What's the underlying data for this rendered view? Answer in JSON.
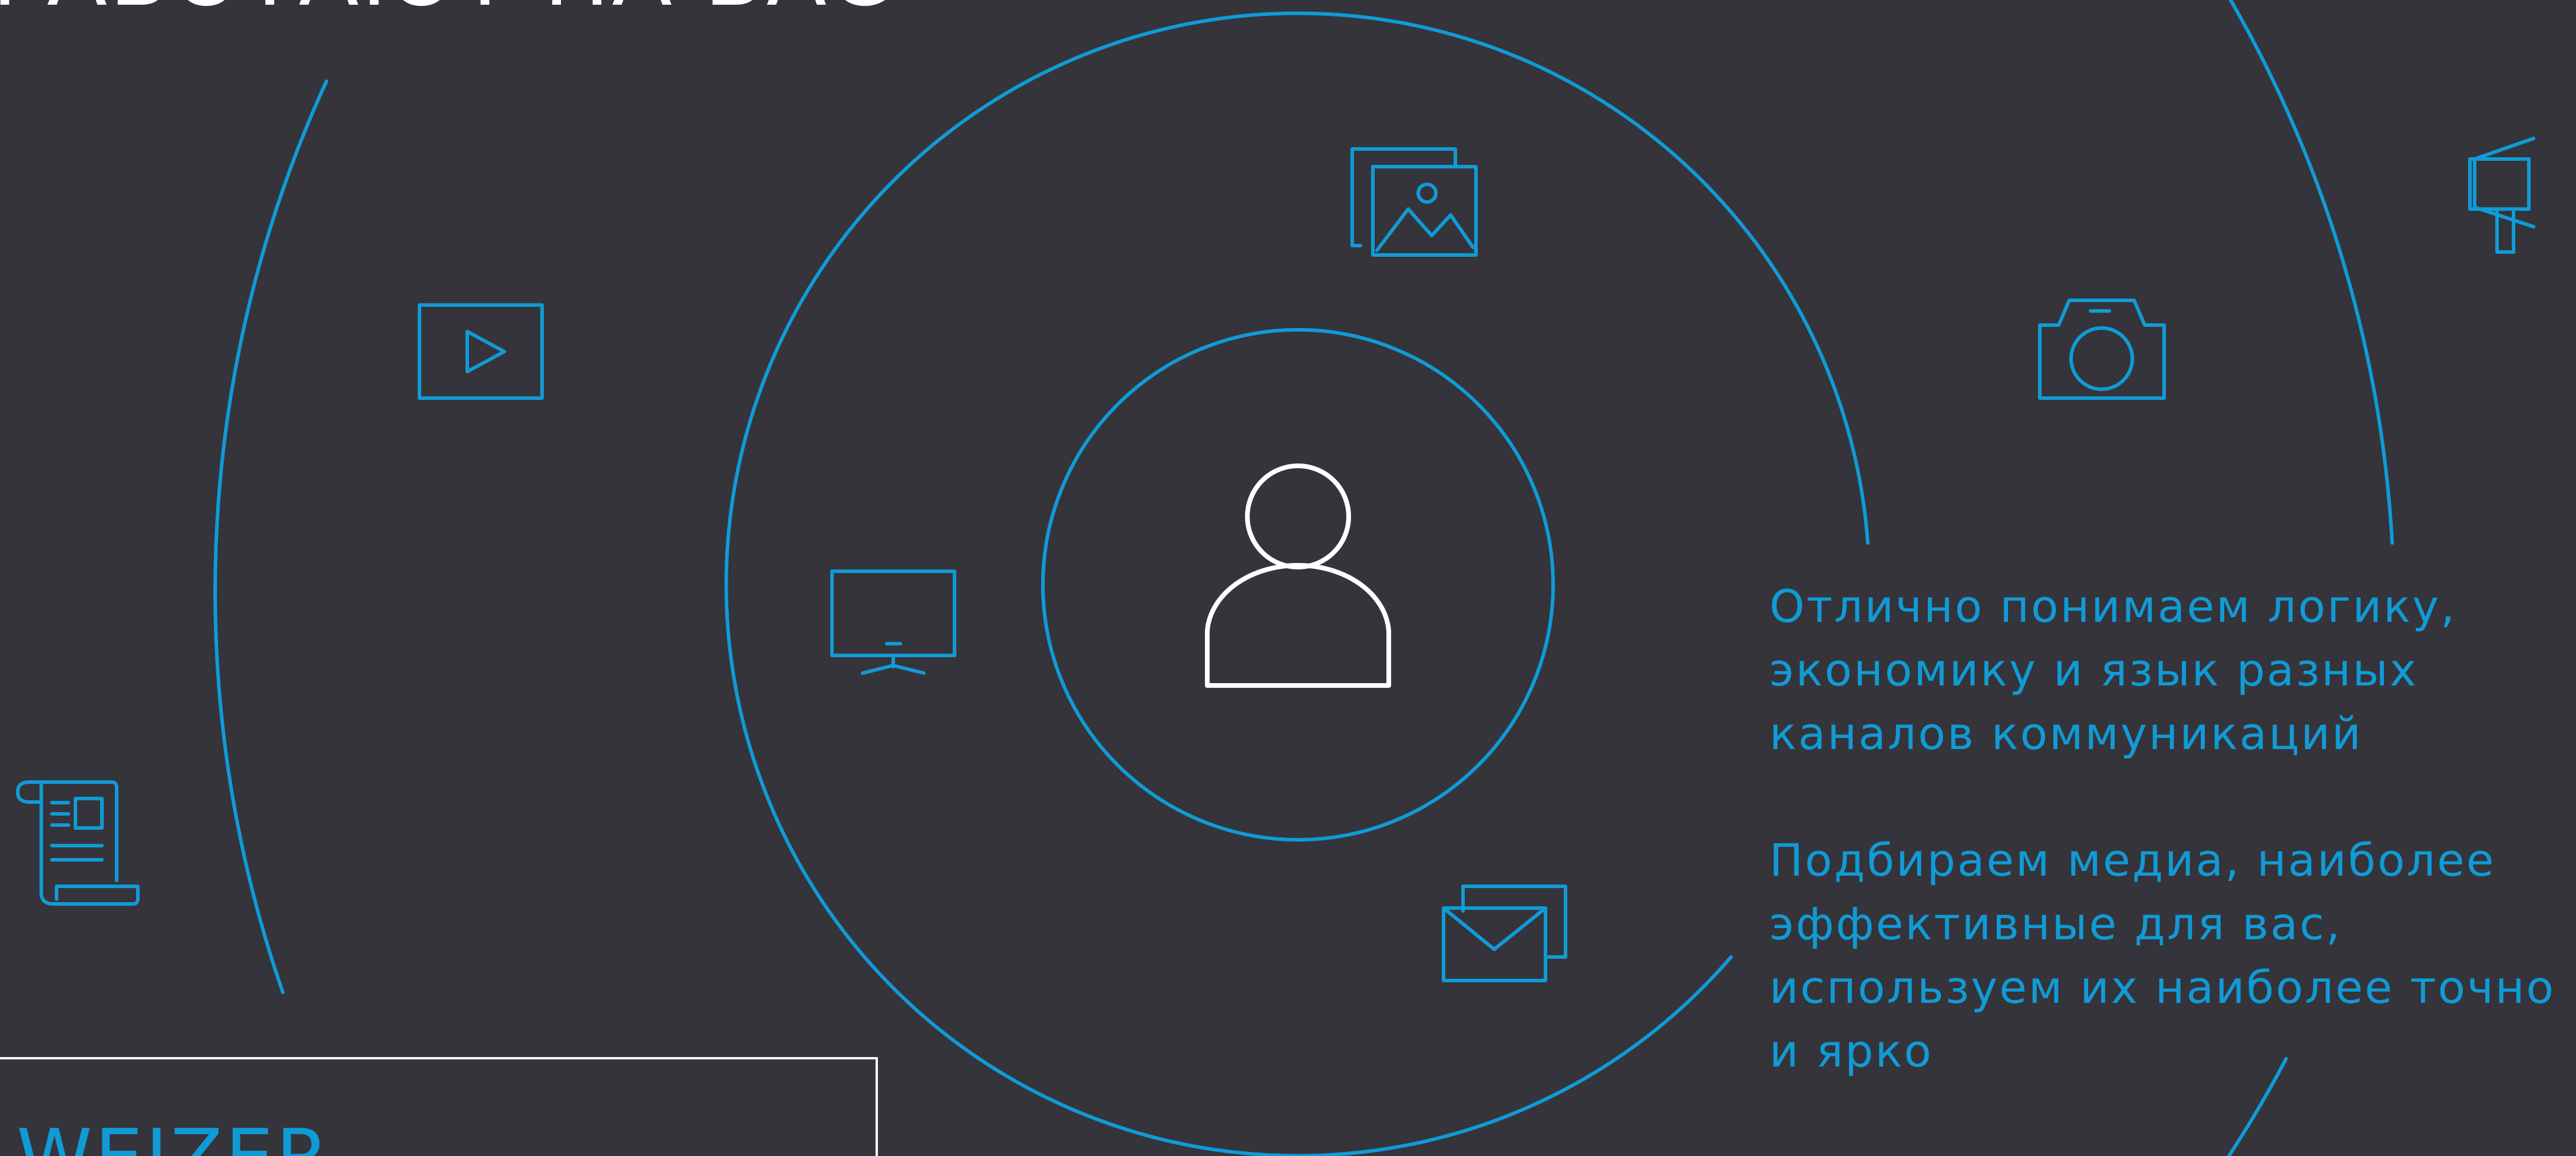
{
  "headline": "РАБОТАЮТ НА ВАС",
  "points": [
    "Отлично понимаем логику, экономику и язык разных каналов коммуникаций",
    "Подбираем медиа, наиболее эффективные для вас, используем их наиболее точно и ярко"
  ],
  "brand": "WEIZER",
  "colors": {
    "background": "#35343a",
    "accent": "#109bd6",
    "center_icon": "#ffffff"
  },
  "icons": {
    "center": "person-icon",
    "channels": [
      "image-gallery-icon",
      "video-play-icon",
      "tv-monitor-icon",
      "email-icon",
      "camera-icon",
      "megaphone-icon",
      "newspaper-scroll-icon"
    ]
  }
}
